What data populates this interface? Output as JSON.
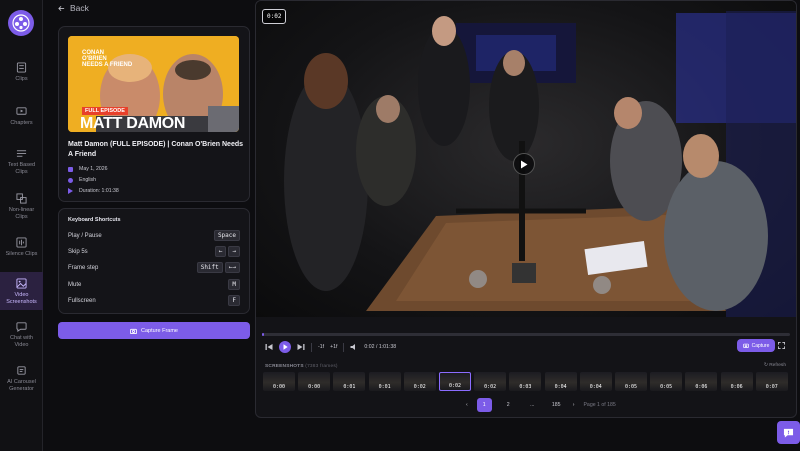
{
  "sidebar": {
    "items": [
      {
        "label": "Clips",
        "icon": "scissors-icon"
      },
      {
        "label": "Chapters",
        "icon": "monitor-icon"
      },
      {
        "label": "Text Based\nClips",
        "icon": "lines-icon"
      },
      {
        "label": "Non-linear\nClips",
        "icon": "layers-icon"
      },
      {
        "label": "Silence Clips",
        "icon": "waveform-icon"
      },
      {
        "label": "Video\nScreenshots",
        "icon": "image-icon",
        "active": true
      },
      {
        "label": "Chat with\nVideo",
        "icon": "chat-icon"
      },
      {
        "label": "AI Carousel\nGenerator",
        "icon": "carousel-icon"
      }
    ]
  },
  "back": {
    "label": "Back"
  },
  "video_info": {
    "thumb_show": "CONAN\nO'BRIEN\nNEEDS A FRIEND",
    "thumb_badge": "FULL EPISODE",
    "thumb_name": "MATT DAMON",
    "title": "Matt Damon (FULL EPISODE) | Conan O'Brien Needs A Friend",
    "date": "May 1, 2026",
    "language": "English",
    "duration": "Duration: 1:01:38"
  },
  "shortcuts": {
    "title": "Keyboard Shortcuts",
    "rows": [
      {
        "label": "Play / Pause",
        "keys": [
          "Space"
        ]
      },
      {
        "label": "Skip 5s",
        "keys": [
          "←",
          "→"
        ]
      },
      {
        "label": "Frame step",
        "keys": [
          "Shift",
          "←→"
        ]
      },
      {
        "label": "Mute",
        "keys": [
          "M"
        ]
      },
      {
        "label": "Fullscreen",
        "keys": [
          "F"
        ]
      }
    ]
  },
  "capture_frame": {
    "label": "Capture Frame"
  },
  "player": {
    "timestamp": "0:02",
    "progress_fraction": 0.001,
    "skip_back": "-1f",
    "skip_fwd": "+1f",
    "time": "0:02 / 1:01:38",
    "capture_label": "Capture"
  },
  "screenshots": {
    "heading": "SCREENSHOTS",
    "count": "(7383 frames)",
    "refresh": "Refresh",
    "items": [
      "0:00",
      "0:00",
      "0:01",
      "0:01",
      "0:02",
      "0:02",
      "0:02",
      "0:03",
      "0:04",
      "0:04",
      "0:05",
      "0:05",
      "0:06",
      "0:06",
      "0:07"
    ],
    "selected_index": 5
  },
  "pagination": {
    "pages": [
      "1",
      "2",
      "...",
      "185"
    ],
    "current": "1",
    "info": "Page 1 of 185"
  },
  "colors": {
    "accent": "#7c5ce8",
    "background": "#0d0d10"
  }
}
